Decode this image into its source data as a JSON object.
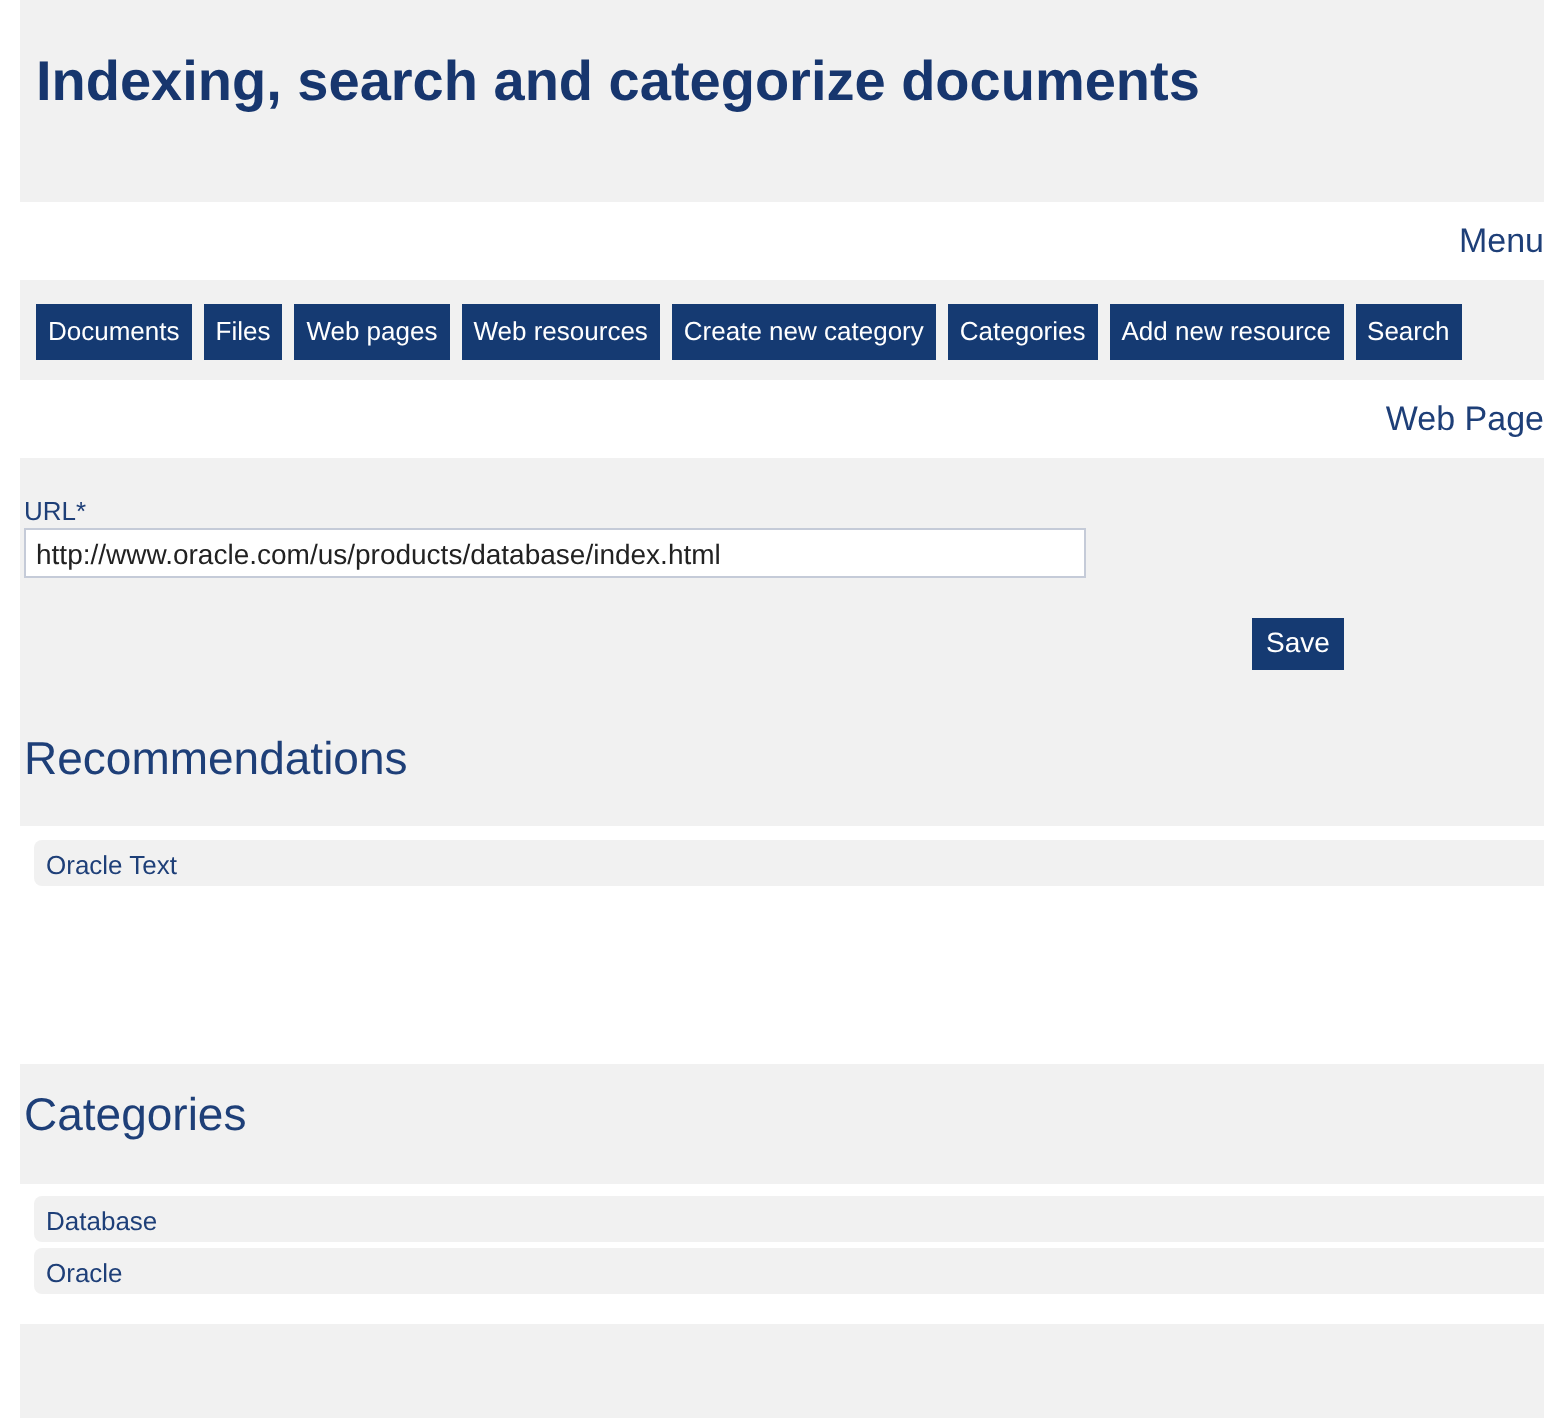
{
  "title": "Indexing, search and categorize documents",
  "menu": {
    "heading": "Menu",
    "buttons": [
      "Documents",
      "Files",
      "Web pages",
      "Web resources",
      "Create new category",
      "Categories",
      "Add new resource",
      "Search"
    ]
  },
  "form": {
    "heading": "Web Page",
    "url_label": "URL*",
    "url_value": "http://www.oracle.com/us/products/database/index.html",
    "save": "Save"
  },
  "recommendations": {
    "heading": "Recommendations",
    "items": [
      "Oracle Text"
    ]
  },
  "categories": {
    "heading": "Categories",
    "items": [
      "Database",
      "Oracle"
    ]
  }
}
